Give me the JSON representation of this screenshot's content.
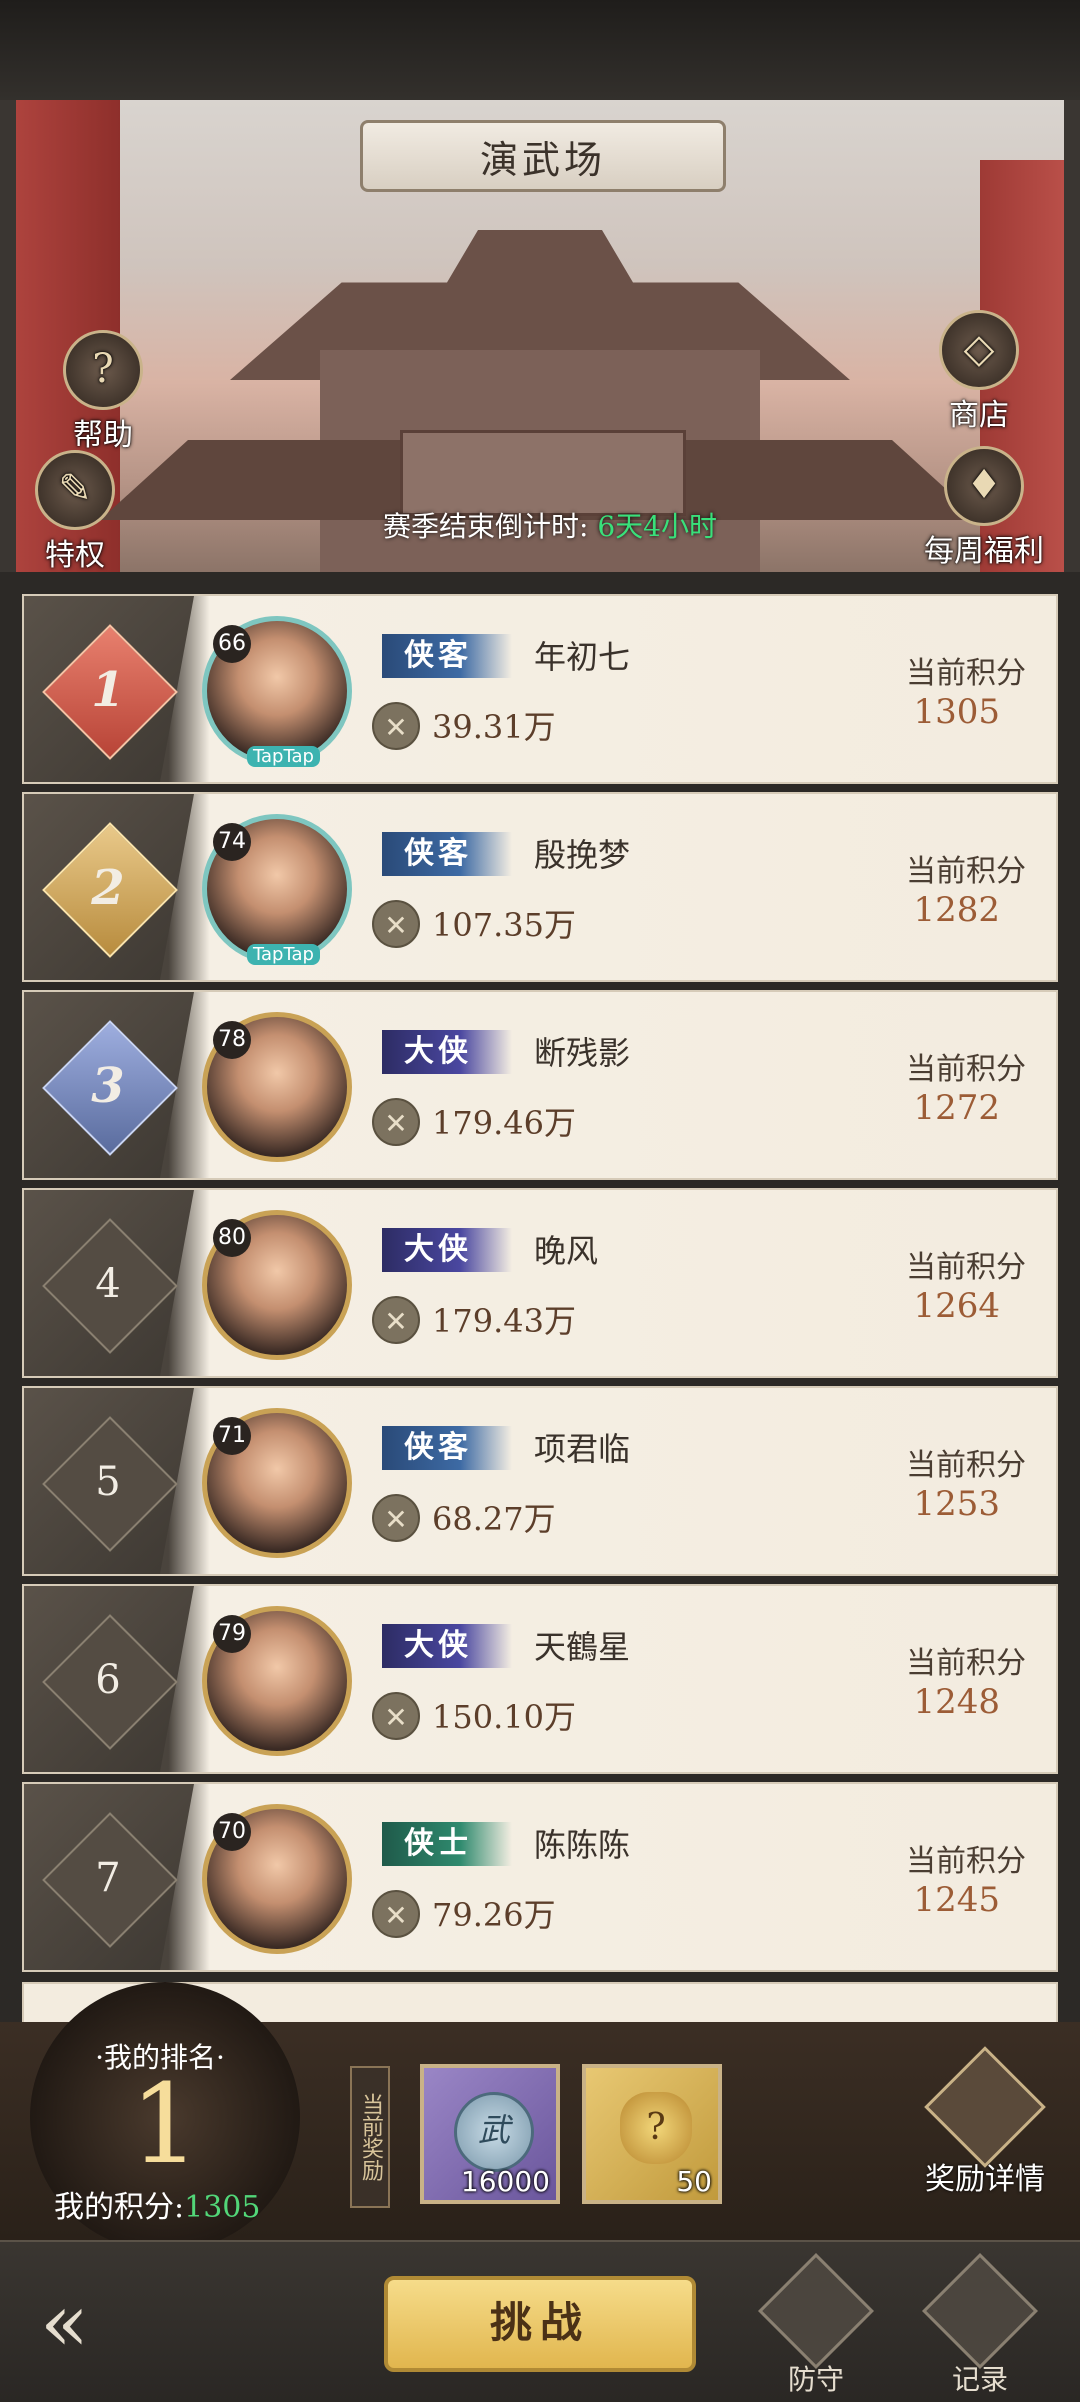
{
  "header": {
    "title": "演武场",
    "countdown_label": "赛季结束倒计时:",
    "countdown_value": "6天4小时"
  },
  "side_buttons": {
    "help": "帮助",
    "privilege": "特权",
    "shop": "商店",
    "weekly": "每周福利"
  },
  "score_label": "当前积分",
  "leaderboard": [
    {
      "rank": "1",
      "level": "66",
      "title": "侠客",
      "name": "年初七",
      "power": "39.31万",
      "score": "1305",
      "platform": "TapTap"
    },
    {
      "rank": "2",
      "level": "74",
      "title": "侠客",
      "name": "殷挽梦",
      "power": "107.35万",
      "score": "1282",
      "platform": "TapTap"
    },
    {
      "rank": "3",
      "level": "78",
      "title": "大侠",
      "name": "断残影",
      "power": "179.46万",
      "score": "1272",
      "platform": ""
    },
    {
      "rank": "4",
      "level": "80",
      "title": "大侠",
      "name": "晚风",
      "power": "179.43万",
      "score": "1264",
      "platform": ""
    },
    {
      "rank": "5",
      "level": "71",
      "title": "侠客",
      "name": "项君临",
      "power": "68.27万",
      "score": "1253",
      "platform": ""
    },
    {
      "rank": "6",
      "level": "79",
      "title": "大侠",
      "name": "天鶴星",
      "power": "150.10万",
      "score": "1248",
      "platform": ""
    },
    {
      "rank": "7",
      "level": "70",
      "title": "侠士",
      "name": "陈陈陈",
      "power": "79.26万",
      "score": "1245",
      "platform": ""
    }
  ],
  "my_rank": {
    "label": "·我的排名·",
    "value": "1",
    "score_label": "我的积分:",
    "score_value": "1305"
  },
  "rewards": {
    "label": "当前奖励",
    "items": [
      {
        "icon": "wu-coin-icon",
        "glyph": "武",
        "qty": "16000"
      },
      {
        "icon": "lucky-bag-icon",
        "glyph": "?",
        "qty": "50"
      }
    ],
    "detail_label": "奖励详情"
  },
  "nav": {
    "challenge": "挑战",
    "defense": "防守",
    "records": "记录"
  }
}
